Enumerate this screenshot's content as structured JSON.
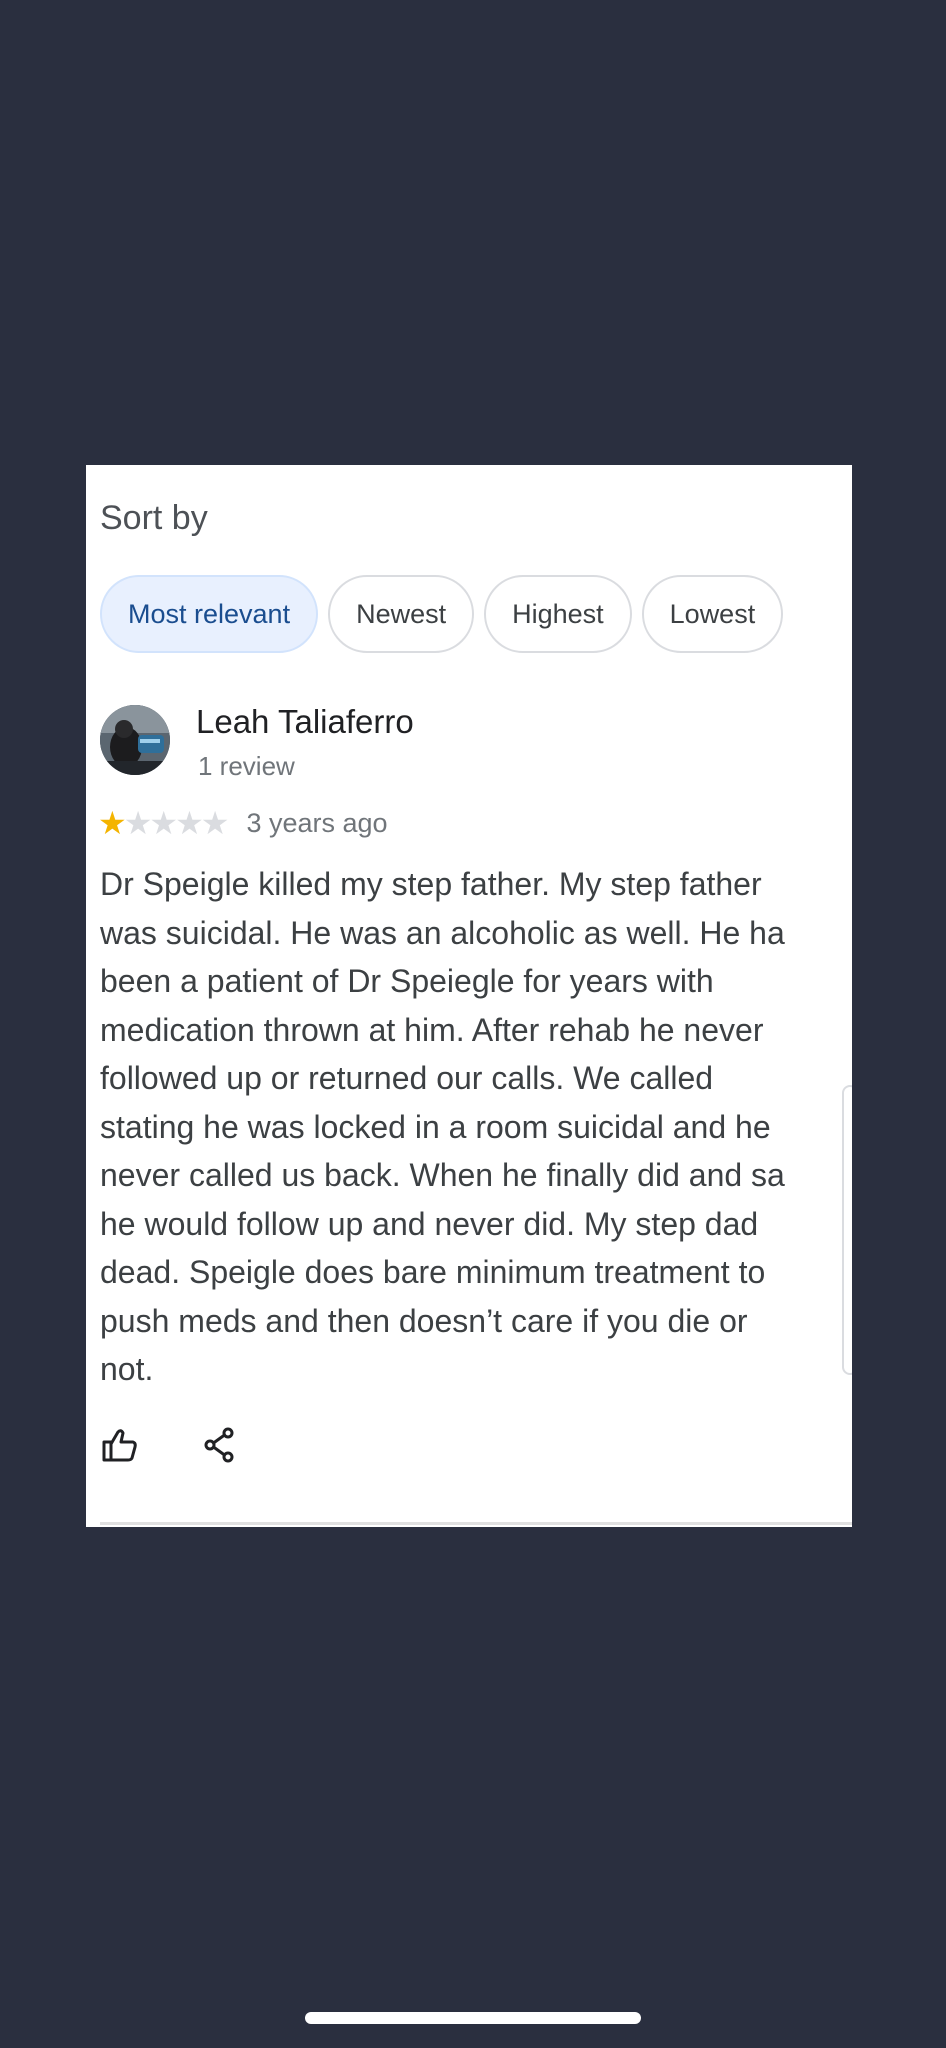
{
  "sort": {
    "label": "Sort by",
    "options": [
      {
        "label": "Most relevant",
        "selected": true
      },
      {
        "label": "Newest",
        "selected": false
      },
      {
        "label": "Highest",
        "selected": false
      },
      {
        "label": "Lowest",
        "selected": false
      }
    ]
  },
  "review": {
    "reviewer_name": "Leah Taliaferro",
    "review_count": "1 review",
    "rating": 1,
    "rating_max": 5,
    "date": "3 years ago",
    "text_lines": [
      "Dr Speigle killed my step father. My step father",
      "was suicidal. He was an alcoholic as well. He ha",
      "been a patient of Dr Speiegle for years with",
      "medication thrown at him. After rehab he never",
      "followed up or returned our calls. We called",
      "stating he was locked in a room suicidal and he",
      "never called us back. When he finally did and sa",
      "he would follow up and never did.  My step dad",
      "dead. Speigle does bare minimum treatment to",
      "push meds and then doesn’t care if you die or",
      "not."
    ]
  },
  "actions": {
    "like_icon": "thumbs-up-icon",
    "share_icon": "share-icon"
  },
  "colors": {
    "background": "#2a2f3f",
    "card": "#ffffff",
    "star_filled": "#f4b400",
    "star_empty": "#dadce0",
    "chip_selected_bg": "#e8f0fe",
    "chip_selected_text": "#1a4d8f"
  }
}
